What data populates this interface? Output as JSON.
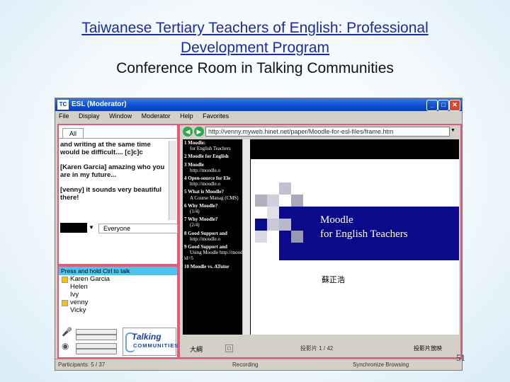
{
  "slide": {
    "title_line1": "Taiwanese Tertiary Teachers of English: Professional",
    "title_line2": "Development Program",
    "subtitle": "Conference Room in Talking Communities",
    "page_number": "51"
  },
  "app": {
    "logo": "TC",
    "title": "ESL (Moderator)",
    "menu": [
      "File",
      "Display",
      "Window",
      "Moderator",
      "Help",
      "Favorites"
    ],
    "window_buttons": [
      "_",
      "□",
      "✕"
    ]
  },
  "chat": {
    "tab": "All",
    "messages": [
      "and writing at the same time would be difficult.... [c]c]c",
      "[Karen Garcia] amazing who you are in my future...",
      "[venny] it sounds very beautiful there!"
    ],
    "recipient": "Everyone"
  },
  "users": {
    "press_hint": "Press and hold Ctrl to talk",
    "list": [
      "Karen Garcia",
      "Helen",
      "Ivy",
      "venny",
      "Vicky"
    ],
    "logo_line1": "Talking",
    "logo_line2": "COMMUNITIES"
  },
  "browser": {
    "url": "http://venny.myweb.hinet.net/paper/Moodle-for-esl-files/frame.htm",
    "outline": [
      {
        "title": "1 Moodle:",
        "sub": "for English Teachers"
      },
      {
        "title": "2 Moodle for English",
        "sub": ""
      },
      {
        "title": "3 Moodle",
        "sub": "http://moodle.o"
      },
      {
        "title": "4 Open-source for Ele",
        "sub": "http://moodle.o"
      },
      {
        "title": "5 What is Moodle?",
        "sub": "A Course Manag (CMS)"
      },
      {
        "title": "6 Why Moodle?",
        "sub": "(1/4)"
      },
      {
        "title": "7 Why Moodle?",
        "sub": "(2/4)"
      },
      {
        "title": "8 Good Support and",
        "sub": "http://moodle.o"
      },
      {
        "title": "9 Good Support and",
        "sub": "Using Moodle http://moodle.o id=5"
      },
      {
        "title": "10 Moodle vs. ATutor",
        "sub": ""
      }
    ],
    "slide_title_1": "Moodle",
    "slide_title_2": "for English Teachers",
    "slide_author": "蘇正浩",
    "prev_label": "大綱",
    "zoom_label": "□",
    "pager": "投影片 1 / 42",
    "next_label": "投影片放映"
  },
  "status": {
    "participants": "Participants: 5 / 37",
    "recording": "Recording",
    "sync": "Synchronize Browsing"
  },
  "colors": {
    "title_link": "#1a2aa8",
    "panel_border": "#e05a7a",
    "slide_blue": "#0a0a8a",
    "press_bar": "#4fc3ee"
  }
}
